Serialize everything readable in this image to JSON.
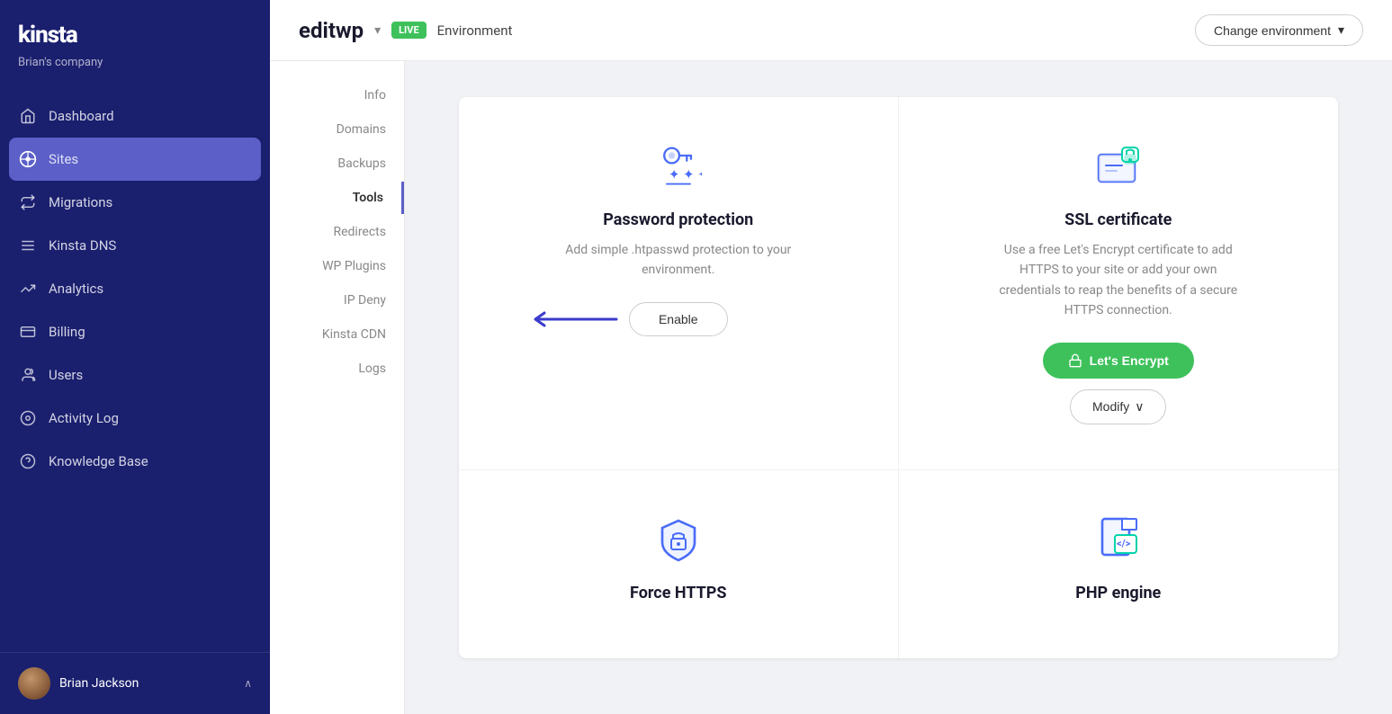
{
  "sidebar": {
    "logo": "kinsta",
    "company": "Brian's company",
    "nav_items": [
      {
        "id": "dashboard",
        "label": "Dashboard",
        "icon": "⌂"
      },
      {
        "id": "sites",
        "label": "Sites",
        "icon": "◈",
        "active": true
      },
      {
        "id": "migrations",
        "label": "Migrations",
        "icon": "⇌"
      },
      {
        "id": "kinsta-dns",
        "label": "Kinsta DNS",
        "icon": "⇄"
      },
      {
        "id": "analytics",
        "label": "Analytics",
        "icon": "↗"
      },
      {
        "id": "billing",
        "label": "Billing",
        "icon": "▣"
      },
      {
        "id": "users",
        "label": "Users",
        "icon": "👤"
      },
      {
        "id": "activity-log",
        "label": "Activity Log",
        "icon": "◎"
      },
      {
        "id": "knowledge-base",
        "label": "Knowledge Base",
        "icon": "?"
      }
    ],
    "user": {
      "name": "Brian Jackson"
    }
  },
  "header": {
    "site_name": "editwp",
    "live_badge": "LIVE",
    "environment_label": "Environment",
    "change_env_button": "Change environment"
  },
  "sub_nav": {
    "items": [
      {
        "id": "info",
        "label": "Info"
      },
      {
        "id": "domains",
        "label": "Domains"
      },
      {
        "id": "backups",
        "label": "Backups"
      },
      {
        "id": "tools",
        "label": "Tools",
        "active": true
      },
      {
        "id": "redirects",
        "label": "Redirects"
      },
      {
        "id": "wp-plugins",
        "label": "WP Plugins"
      },
      {
        "id": "ip-deny",
        "label": "IP Deny"
      },
      {
        "id": "kinsta-cdn",
        "label": "Kinsta CDN"
      },
      {
        "id": "logs",
        "label": "Logs"
      }
    ]
  },
  "tools": {
    "password_protection": {
      "title": "Password protection",
      "description": "Add simple .htpasswd protection to your environment.",
      "button_label": "Enable"
    },
    "ssl_certificate": {
      "title": "SSL certificate",
      "description": "Use a free Let's Encrypt certificate to add HTTPS to your site or add your own credentials to reap the benefits of a secure HTTPS connection.",
      "lets_encrypt_button": "Let's Encrypt",
      "modify_button": "Modify"
    },
    "force_https": {
      "title": "Force HTTPS"
    },
    "php_engine": {
      "title": "PHP engine"
    }
  }
}
